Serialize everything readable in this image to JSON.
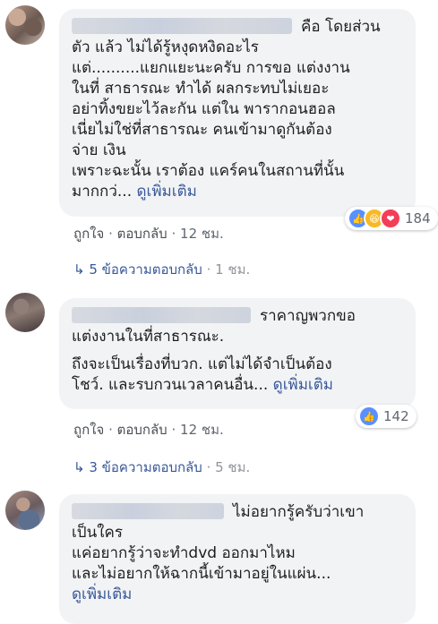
{
  "comments": [
    {
      "lines": [
        "คือ โดยส่วน",
        "ตัว แล้ว ไม่ได้รู้หงุดหงิดอะไร",
        "แต่..........แยกแยะนะครับ การขอ แต่งงาน",
        "ในที่ สาธารณะ ทำได้ ผลกระทบไม่เยอะ",
        "อย่าทิ้งขยะไว้ละกัน แต่ใน พารากอนฮอล",
        "เนี่ยไม่ใช่ที่สาธารณะ คนเข้ามาดูกันต้อง",
        "จ่าย เงิน",
        "เพราะฉะนั้น เราต้อง แคร์คนในสถานที่นั้น",
        "มากกว่... "
      ],
      "see_more": "ดูเพิ่มเติม",
      "like": "ถูกใจ",
      "reply": "ตอบกลับ",
      "time": "12 ชม.",
      "reaction_count": "184",
      "replies_link": "5 ข้อความตอบกลับ",
      "replies_time": "1 ชม.",
      "reaction_icons": [
        "thumbs-up-icon",
        "haha-icon",
        "love-icon"
      ]
    },
    {
      "lines": [
        "ราคาญพวกขอ",
        "แต่งงานในที่สาธารณะ.",
        "ถึงจะเป็นเรื่องที่บวก. แต่ไม่ได้จำเป็นต้อง",
        "โชว์. และรบกวนเวลาคนอื่น... "
      ],
      "see_more": "ดูเพิ่มเติม",
      "like": "ถูกใจ",
      "reply": "ตอบกลับ",
      "time": "12 ชม.",
      "reaction_count": "142",
      "replies_link": "3 ข้อความตอบกลับ",
      "replies_time": "5 ชม.",
      "reaction_icons": [
        "thumbs-up-icon"
      ]
    },
    {
      "lines": [
        "ไม่อยากรู้ครับว่าเขา",
        "เป็นใคร",
        "แค่อยากรู้ว่าจะทำdvd ออกมาไหม",
        "และไม่อยากให้ฉากนี้เข้ามาอยู่ในแผ่น..."
      ],
      "see_more": "ดูเพิ่มเติม"
    }
  ],
  "separator": "·",
  "reply_arrow": "↳",
  "colors": {
    "link": "#385898",
    "bubble": "#f2f3f5",
    "like_blue": "#5890ff",
    "haha_yellow": "#f7b928",
    "love_red": "#f33e58"
  }
}
